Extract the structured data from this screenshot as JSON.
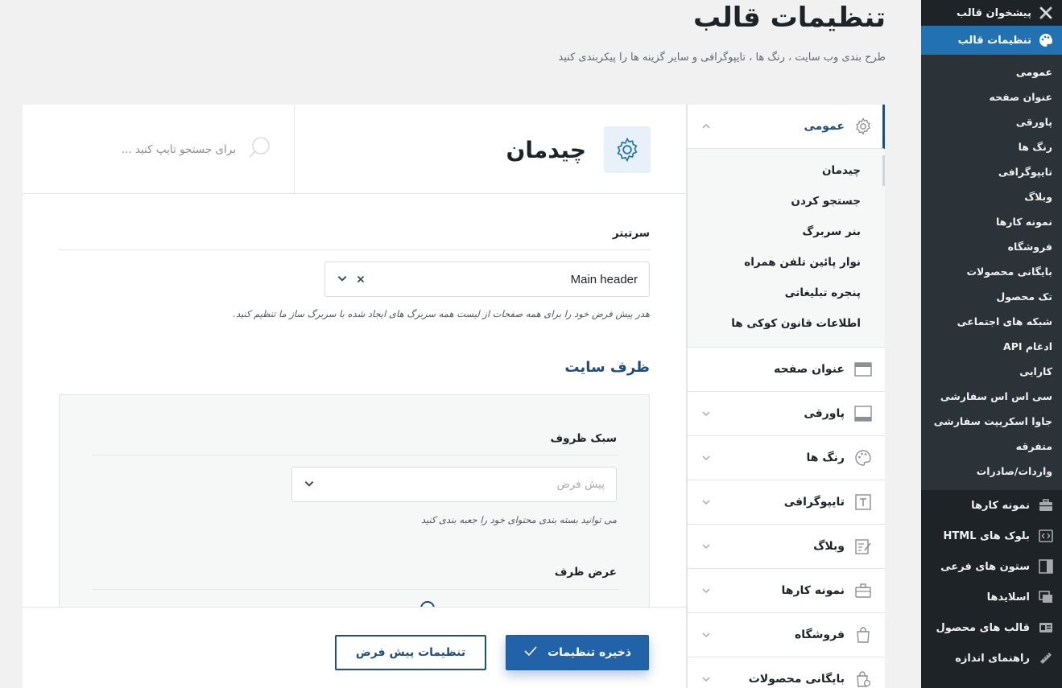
{
  "header": {
    "title": "تنظیمات قالب",
    "subtitle": "طرح بندی وب سایت ، رنگ ها ، تایپوگرافی و سایر گزینه ها را پیکربندی کنید"
  },
  "wp_sidebar": {
    "dashboard_label": "پیشخوان قالب",
    "current_label": "تنظیمات قالب",
    "submenu": [
      "عمومی",
      "عنوان صفحه",
      "پاورقی",
      "رنگ ها",
      "تایپوگرافی",
      "وبلاگ",
      "نمونه کارها",
      "فروشگاه",
      "بایگانی محصولات",
      "تک محصول",
      "شبکه های اجتماعی",
      "ادغام API",
      "کارایی",
      "سی اس اس سفارشی",
      "جاوا اسکریپت سفارشی",
      "متفرقه",
      "واردات/صادرات"
    ],
    "menu": [
      {
        "label": "نمونه کارها",
        "icon": "briefcase-icon"
      },
      {
        "label": "بلوک های HTML",
        "icon": "code-block-icon"
      },
      {
        "label": "ستون های فرعی",
        "icon": "sidebar-icon"
      },
      {
        "label": "اسلایدها",
        "icon": "slides-icon"
      },
      {
        "label": "قالب های محصول",
        "icon": "product-template-icon"
      },
      {
        "label": "راهنمای اندازه",
        "icon": "ruler-icon"
      }
    ]
  },
  "panel_nav": {
    "general": {
      "label": "عمومی",
      "children": [
        "چیدمان",
        "جستجو کردن",
        "بنر سربرگ",
        "نوار پائین تلفن همراه",
        "پنجره تبلیغاتی",
        "اطلاعات قانون کوکی ها"
      ]
    },
    "sections": [
      {
        "label": "عنوان صفحه",
        "icon": "page-title-icon"
      },
      {
        "label": "پاورقی",
        "icon": "footer-icon"
      },
      {
        "label": "رنگ ها",
        "icon": "palette-icon"
      },
      {
        "label": "تایپوگرافی",
        "icon": "typography-icon"
      },
      {
        "label": "وبلاگ",
        "icon": "blog-icon"
      },
      {
        "label": "نمونه کارها",
        "icon": "portfolio-icon"
      },
      {
        "label": "فروشگاه",
        "icon": "shop-icon"
      },
      {
        "label": "بایگانی محصولات",
        "icon": "product-archive-icon"
      }
    ]
  },
  "content": {
    "section_title": "چیدمان",
    "search_placeholder": "برای جستجو تایپ کنید ...",
    "header_field": {
      "label": "سرتیتر",
      "value": "Main header",
      "help": "هدر پیش فرض خود را برای همه صفحات از لیست همه سربرگ های ایجاد شده با سربرگ ساز ما تنظیم کنید."
    },
    "site_container_title": "ظرف سایت",
    "container_style": {
      "label": "سبک ظروف",
      "placeholder": "پیش فرض",
      "help": "می توانید بسته بندی محتوای خود را جعبه بندی کنید"
    },
    "container_width_label": "عرض ظرف"
  },
  "footer": {
    "save_label": "ذخیره تنظیمات",
    "default_label": "تنظیمات پیش فرض"
  },
  "colors": {
    "wp_sidebar_bg": "#1d2327",
    "wp_current": "#2271b1",
    "accent": "#1e4d80",
    "save_button": "#2262a8"
  }
}
